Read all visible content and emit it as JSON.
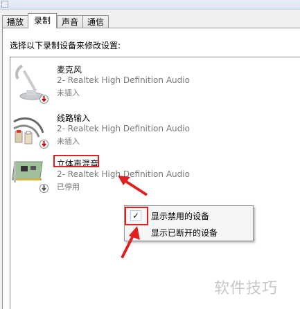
{
  "tabs": [
    {
      "label": "播放"
    },
    {
      "label": "录制"
    },
    {
      "label": "声音"
    },
    {
      "label": "通信"
    }
  ],
  "active_tab": "录制",
  "instruction": "选择以下录制设备来修改设置:",
  "devices": [
    {
      "name": "麦克风",
      "driver": "2- Realtek High Definition Audio",
      "status": "未插入",
      "icon": "microphone-icon"
    },
    {
      "name": "线路输入",
      "driver": "2- Realtek High Definition Audio",
      "status": "未插入",
      "icon": "line-in-cable-icon"
    },
    {
      "name": "立体声混音",
      "driver": "2- Realtek High Definition Audio",
      "status": "已停用",
      "icon": "sound-card-icon"
    }
  ],
  "context_menu": {
    "items": [
      {
        "label": "显示禁用的设备",
        "checked": true,
        "check_glyph": "✓"
      },
      {
        "label": "显示已断开的设备",
        "checked": false,
        "check_glyph": ""
      }
    ]
  },
  "watermark": "软件技巧",
  "colors": {
    "annotation_red": "#e02020",
    "status_gray": "#777777"
  }
}
